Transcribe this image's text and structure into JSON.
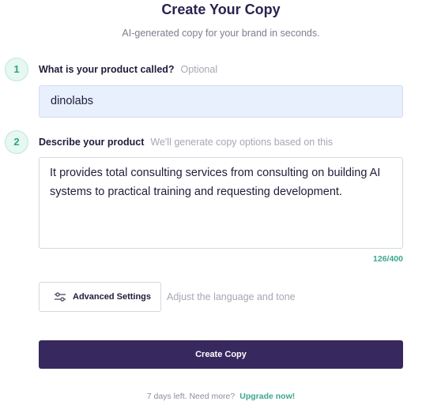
{
  "header": {
    "title": "Create Your Copy",
    "subtitle": "AI-generated copy for your brand in seconds."
  },
  "steps": [
    {
      "number": "1",
      "label": "What is your product called?",
      "hint": "Optional",
      "value": "dinolabs"
    },
    {
      "number": "2",
      "label": "Describe your product",
      "hint": "We'll generate copy options based on this",
      "value": "It provides total consulting services from consulting on building AI systems to practical training and requesting development."
    }
  ],
  "char_counter": "126/400",
  "advanced": {
    "button_label": "Advanced Settings",
    "icon": "sliders-icon",
    "hint": "Adjust the language and tone"
  },
  "create_button_label": "Create Copy",
  "footer": {
    "text": "7 days left. Need more?",
    "link": "Upgrade now!"
  },
  "colors": {
    "primary": "#37285e",
    "accent": "#3da78c",
    "input_bg": "#e8effd"
  }
}
